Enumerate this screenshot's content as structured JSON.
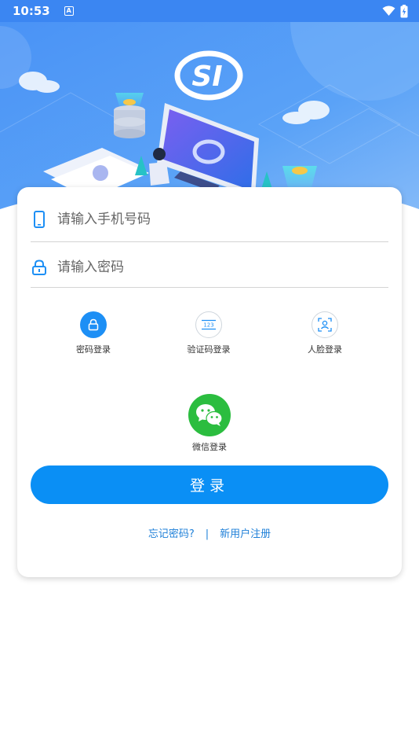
{
  "status_bar": {
    "time": "10:53",
    "notification_icon": "A"
  },
  "banner": {
    "logo_text": "SI"
  },
  "form": {
    "phone_placeholder": "请输入手机号码",
    "password_placeholder": "请输入密码"
  },
  "login_methods": [
    {
      "label": "密码登录",
      "icon": "lock-icon"
    },
    {
      "label": "验证码登录",
      "icon": "code-123-icon"
    },
    {
      "label": "人脸登录",
      "icon": "face-scan-icon"
    }
  ],
  "wechat": {
    "label": "微信登录"
  },
  "login_button": {
    "label": "登录"
  },
  "links": {
    "forgot": "忘记密码?",
    "separator": "|",
    "register": "新用户注册"
  },
  "colors": {
    "accent": "#0a8ff5",
    "wechat": "#2bbd3f",
    "status_bar": "#3b86f2"
  }
}
